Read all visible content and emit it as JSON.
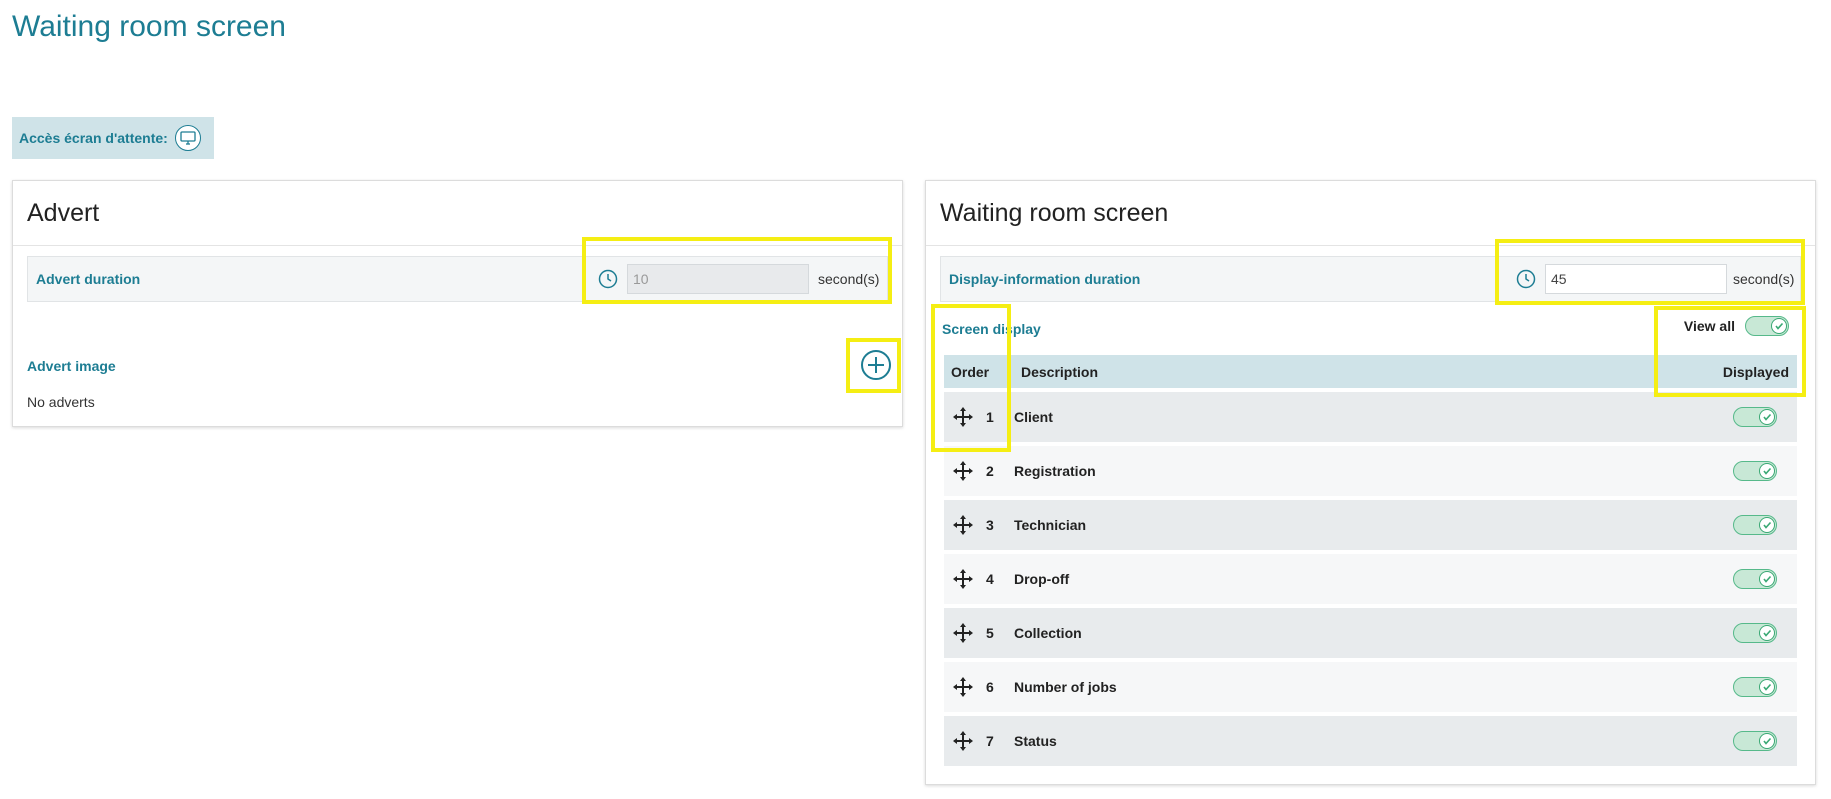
{
  "page": {
    "title": "Waiting room screen"
  },
  "access": {
    "label": "Accès écran d'attente:",
    "icon": "monitor-icon"
  },
  "advert_panel": {
    "title": "Advert",
    "duration_label": "Advert duration",
    "duration_value": "10",
    "duration_unit": "second(s)",
    "image_label": "Advert image",
    "empty_text": "No adverts",
    "add_icon": "plus-circle-icon"
  },
  "screen_panel": {
    "title": "Waiting room screen",
    "duration_label": "Display-information duration",
    "duration_value": "45",
    "duration_unit": "second(s)",
    "display_label": "Screen display",
    "view_all_label": "View all",
    "view_all_on": true,
    "columns": {
      "order": "Order",
      "description": "Description",
      "displayed": "Displayed"
    },
    "rows": [
      {
        "order": "1",
        "description": "Client",
        "displayed": true
      },
      {
        "order": "2",
        "description": "Registration",
        "displayed": true
      },
      {
        "order": "3",
        "description": "Technician",
        "displayed": true
      },
      {
        "order": "4",
        "description": "Drop-off",
        "displayed": true
      },
      {
        "order": "5",
        "description": "Collection",
        "displayed": true
      },
      {
        "order": "6",
        "description": "Number of jobs",
        "displayed": true
      },
      {
        "order": "7",
        "description": "Status",
        "displayed": true
      }
    ]
  },
  "colors": {
    "accent": "#1d7d93",
    "header_bg": "#cfe3e8",
    "toggle_on": "#56b98a",
    "highlight": "#f5ee13"
  }
}
